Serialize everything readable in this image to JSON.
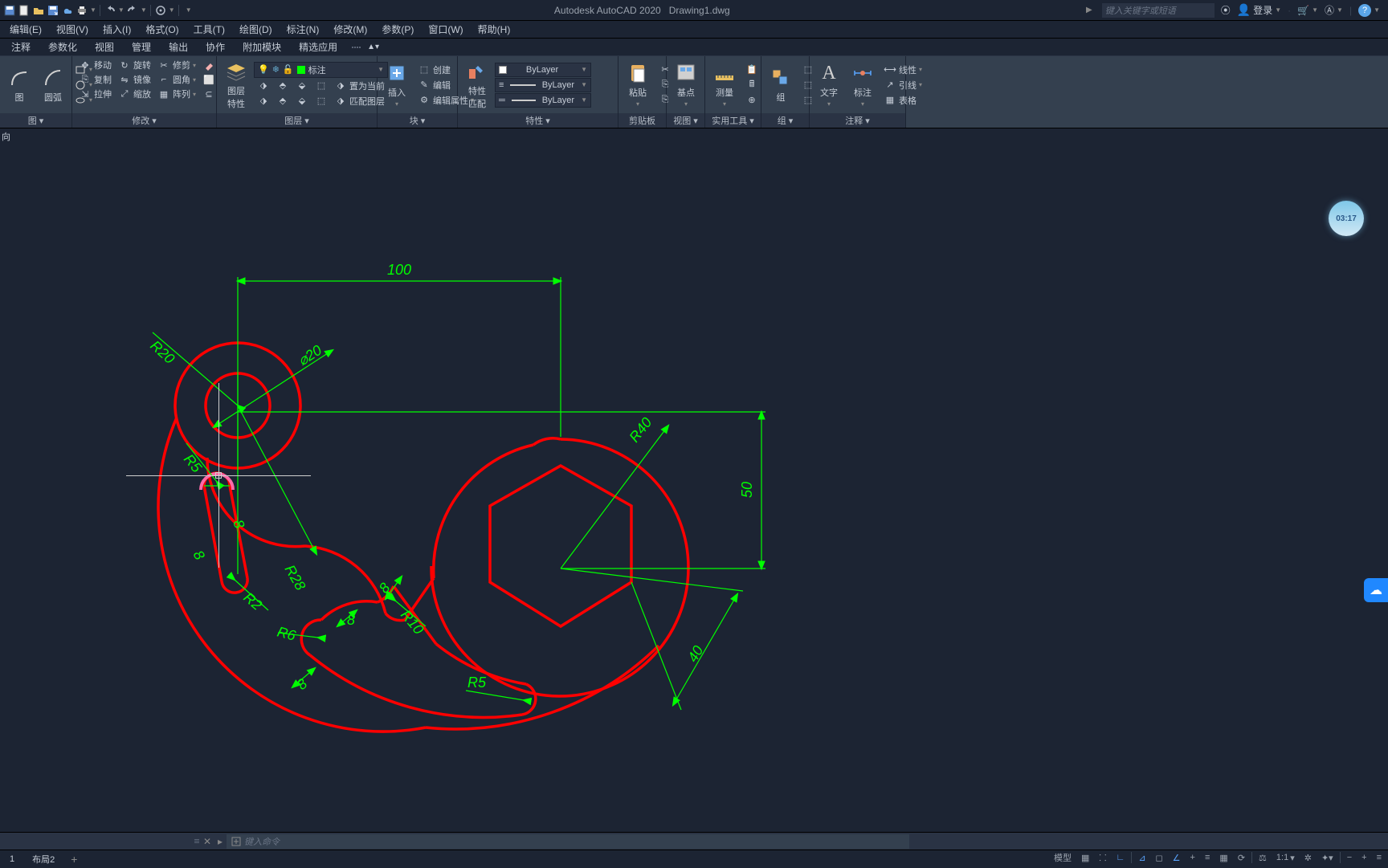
{
  "title": {
    "app": "Autodesk AutoCAD 2020",
    "file": "Drawing1.dwg"
  },
  "search": {
    "placeholder": "键入关键字或短语"
  },
  "titlebar_right": {
    "login": "登录"
  },
  "menubar": [
    "编辑(E)",
    "视图(V)",
    "插入(I)",
    "格式(O)",
    "工具(T)",
    "绘图(D)",
    "标注(N)",
    "修改(M)",
    "参数(P)",
    "窗口(W)",
    "帮助(H)"
  ],
  "ribbon_tabs": [
    "注释",
    "参数化",
    "视图",
    "管理",
    "输出",
    "协作",
    "附加模块",
    "精选应用"
  ],
  "panels": {
    "draw": {
      "title": "图 ▾",
      "arc": "圆弧"
    },
    "modify": {
      "title": "修改 ▾",
      "row1": [
        "移动",
        "旋转",
        "修剪"
      ],
      "row2": [
        "复制",
        "镜像",
        "圆角"
      ],
      "row3": [
        "拉伸",
        "缩放",
        "阵列"
      ]
    },
    "layer": {
      "title": "图层 ▾",
      "big": "图层\n特性",
      "current_layer": "标注",
      "btns_r1": [
        "置为当前"
      ],
      "btns_r2": [
        "匹配图层"
      ]
    },
    "block": {
      "title": "块 ▾",
      "insert": "插入",
      "row1": "创建",
      "row2": "编辑",
      "row3": "编辑属性"
    },
    "properties": {
      "title": "特性 ▾",
      "big": "特性\n匹配",
      "color": "ByLayer",
      "lw": "ByLayer",
      "lt": "ByLayer"
    },
    "clipboard": {
      "title": "剪贴板",
      "big": "粘贴"
    },
    "view": {
      "title": "视图 ▾",
      "big": "基点"
    },
    "utils": {
      "title": "实用工具 ▾",
      "big": "测量"
    },
    "group": {
      "title": "组 ▾",
      "big": "组"
    },
    "annot": {
      "title": "注释 ▾",
      "text": "文字",
      "dim": "标注",
      "row1": "线性",
      "row2": "引线",
      "row3": "表格"
    }
  },
  "canvas": {
    "ucs_label": "向",
    "dims": {
      "d100": "100",
      "d50": "50",
      "d40": "40",
      "r20": "R20",
      "phi20": "⌀20",
      "r40": "R40",
      "r5a": "R5",
      "r28": "R28",
      "r2": "R2",
      "d8a": "8",
      "d8b": "8",
      "d8c": "8",
      "d8d": "8",
      "d8e": "8",
      "r6": "R6",
      "r10": "R10",
      "r5b": "R5"
    }
  },
  "clock": "03:17",
  "command": {
    "placeholder": "键入命令"
  },
  "layout_tabs": [
    "1",
    "布局2"
  ],
  "status": {
    "model": "模型",
    "grid": "▦",
    "scale": "1:1",
    "buttons": [
      "+",
      "╱",
      "∟",
      "⊿",
      "✎",
      "▦",
      "☺",
      "⌖"
    ]
  }
}
